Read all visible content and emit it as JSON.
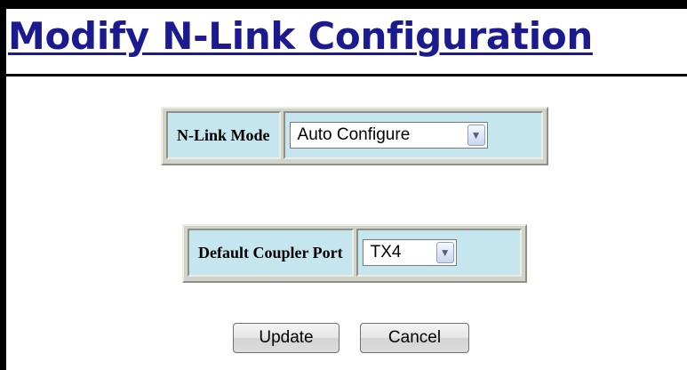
{
  "page": {
    "title": "Modify N-Link Configuration"
  },
  "nlink_mode": {
    "label": "N-Link Mode",
    "value": "Auto Configure",
    "arrow": "chevron-down-icon"
  },
  "default_coupler_port": {
    "label": "Default Coupler Port",
    "value": "TX4",
    "arrow": "chevron-down-icon"
  },
  "actions": {
    "update_label": "Update",
    "cancel_label": "Cancel"
  },
  "colors": {
    "title": "#1b1b8f",
    "label_cell_bg": "#c6e6ef",
    "table_bg": "#d2d3c9"
  }
}
